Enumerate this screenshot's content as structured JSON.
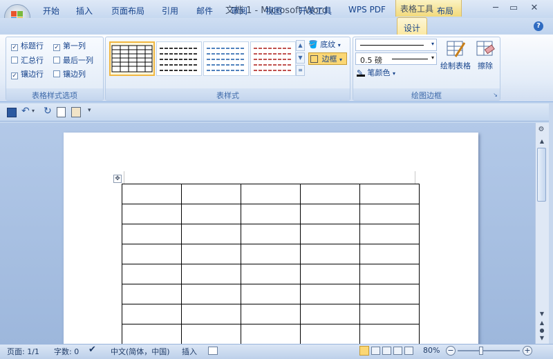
{
  "window": {
    "title": "文档 1 - Microsoft Word",
    "contextual_header": "表格工具",
    "minimize": "─",
    "restore": "▭",
    "close": "✕"
  },
  "tabs": [
    "开始",
    "插入",
    "页面布局",
    "引用",
    "邮件",
    "审阅",
    "视图",
    "开发工具",
    "WPS PDF",
    "设计",
    "布局"
  ],
  "active_tab": "设计",
  "help": "?",
  "ribbon": {
    "table_style_options": {
      "label": "表格样式选项",
      "options": [
        {
          "label": "标题行",
          "checked": true
        },
        {
          "label": "第一列",
          "checked": true
        },
        {
          "label": "汇总行",
          "checked": false
        },
        {
          "label": "最后一列",
          "checked": false
        },
        {
          "label": "镶边行",
          "checked": true
        },
        {
          "label": "镶边列",
          "checked": false
        }
      ]
    },
    "table_styles": {
      "label": "表样式",
      "shading_label": "底纹",
      "borders_label": "边框"
    },
    "draw_borders": {
      "label": "绘图边框",
      "weight": "0.5 磅",
      "pen_color_label": "笔颜色",
      "draw_table_label": "绘制表格",
      "eraser_label": "擦除"
    }
  },
  "status": {
    "page": "页面: 1/1",
    "words": "字数: 0",
    "language": "中文(简体，中国)",
    "mode": "插入",
    "zoom": "80%"
  },
  "colors": {
    "accent": "#15428b",
    "active_tab": "#fbe9a5",
    "selection_border": "#f1b740"
  }
}
